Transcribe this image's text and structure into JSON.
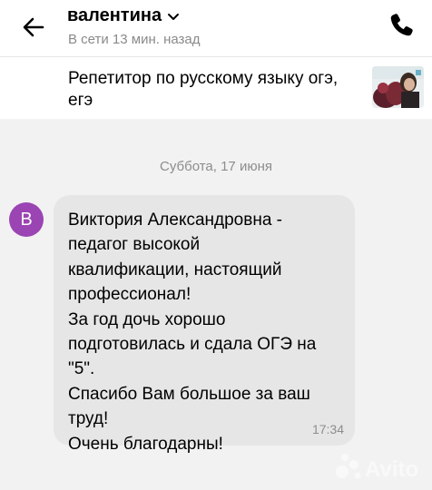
{
  "header": {
    "contact_name": "валентина",
    "status": "В сети 13 мин. назад",
    "back_icon": "arrow-left-icon",
    "call_icon": "phone-icon",
    "chevron_icon": "chevron-down-icon"
  },
  "listing": {
    "title": "Репетитор по русскому языку огэ, егэ",
    "thumbnail": "listing-photo"
  },
  "chat": {
    "date_separator": "Суббота, 17 июня",
    "messages": [
      {
        "avatar_letter": "В",
        "avatar_color": "#9b44b3",
        "text": "Виктория Александровна -\nпедагог высокой\nквалификации, настоящий\nпрофессионал!\nЗа год дочь хорошо\nподготовилась и сдала ОГЭ на\n\"5\".\nСпасибо Вам большое за ваш\nтруд!\nОчень благодарны!",
        "time": "17:34"
      }
    ]
  },
  "watermark": {
    "text": "Avito"
  },
  "colors": {
    "chat_background": "#f2f2f2",
    "bubble_background": "#e6e6e6",
    "secondary_text": "#8a8a8a"
  }
}
